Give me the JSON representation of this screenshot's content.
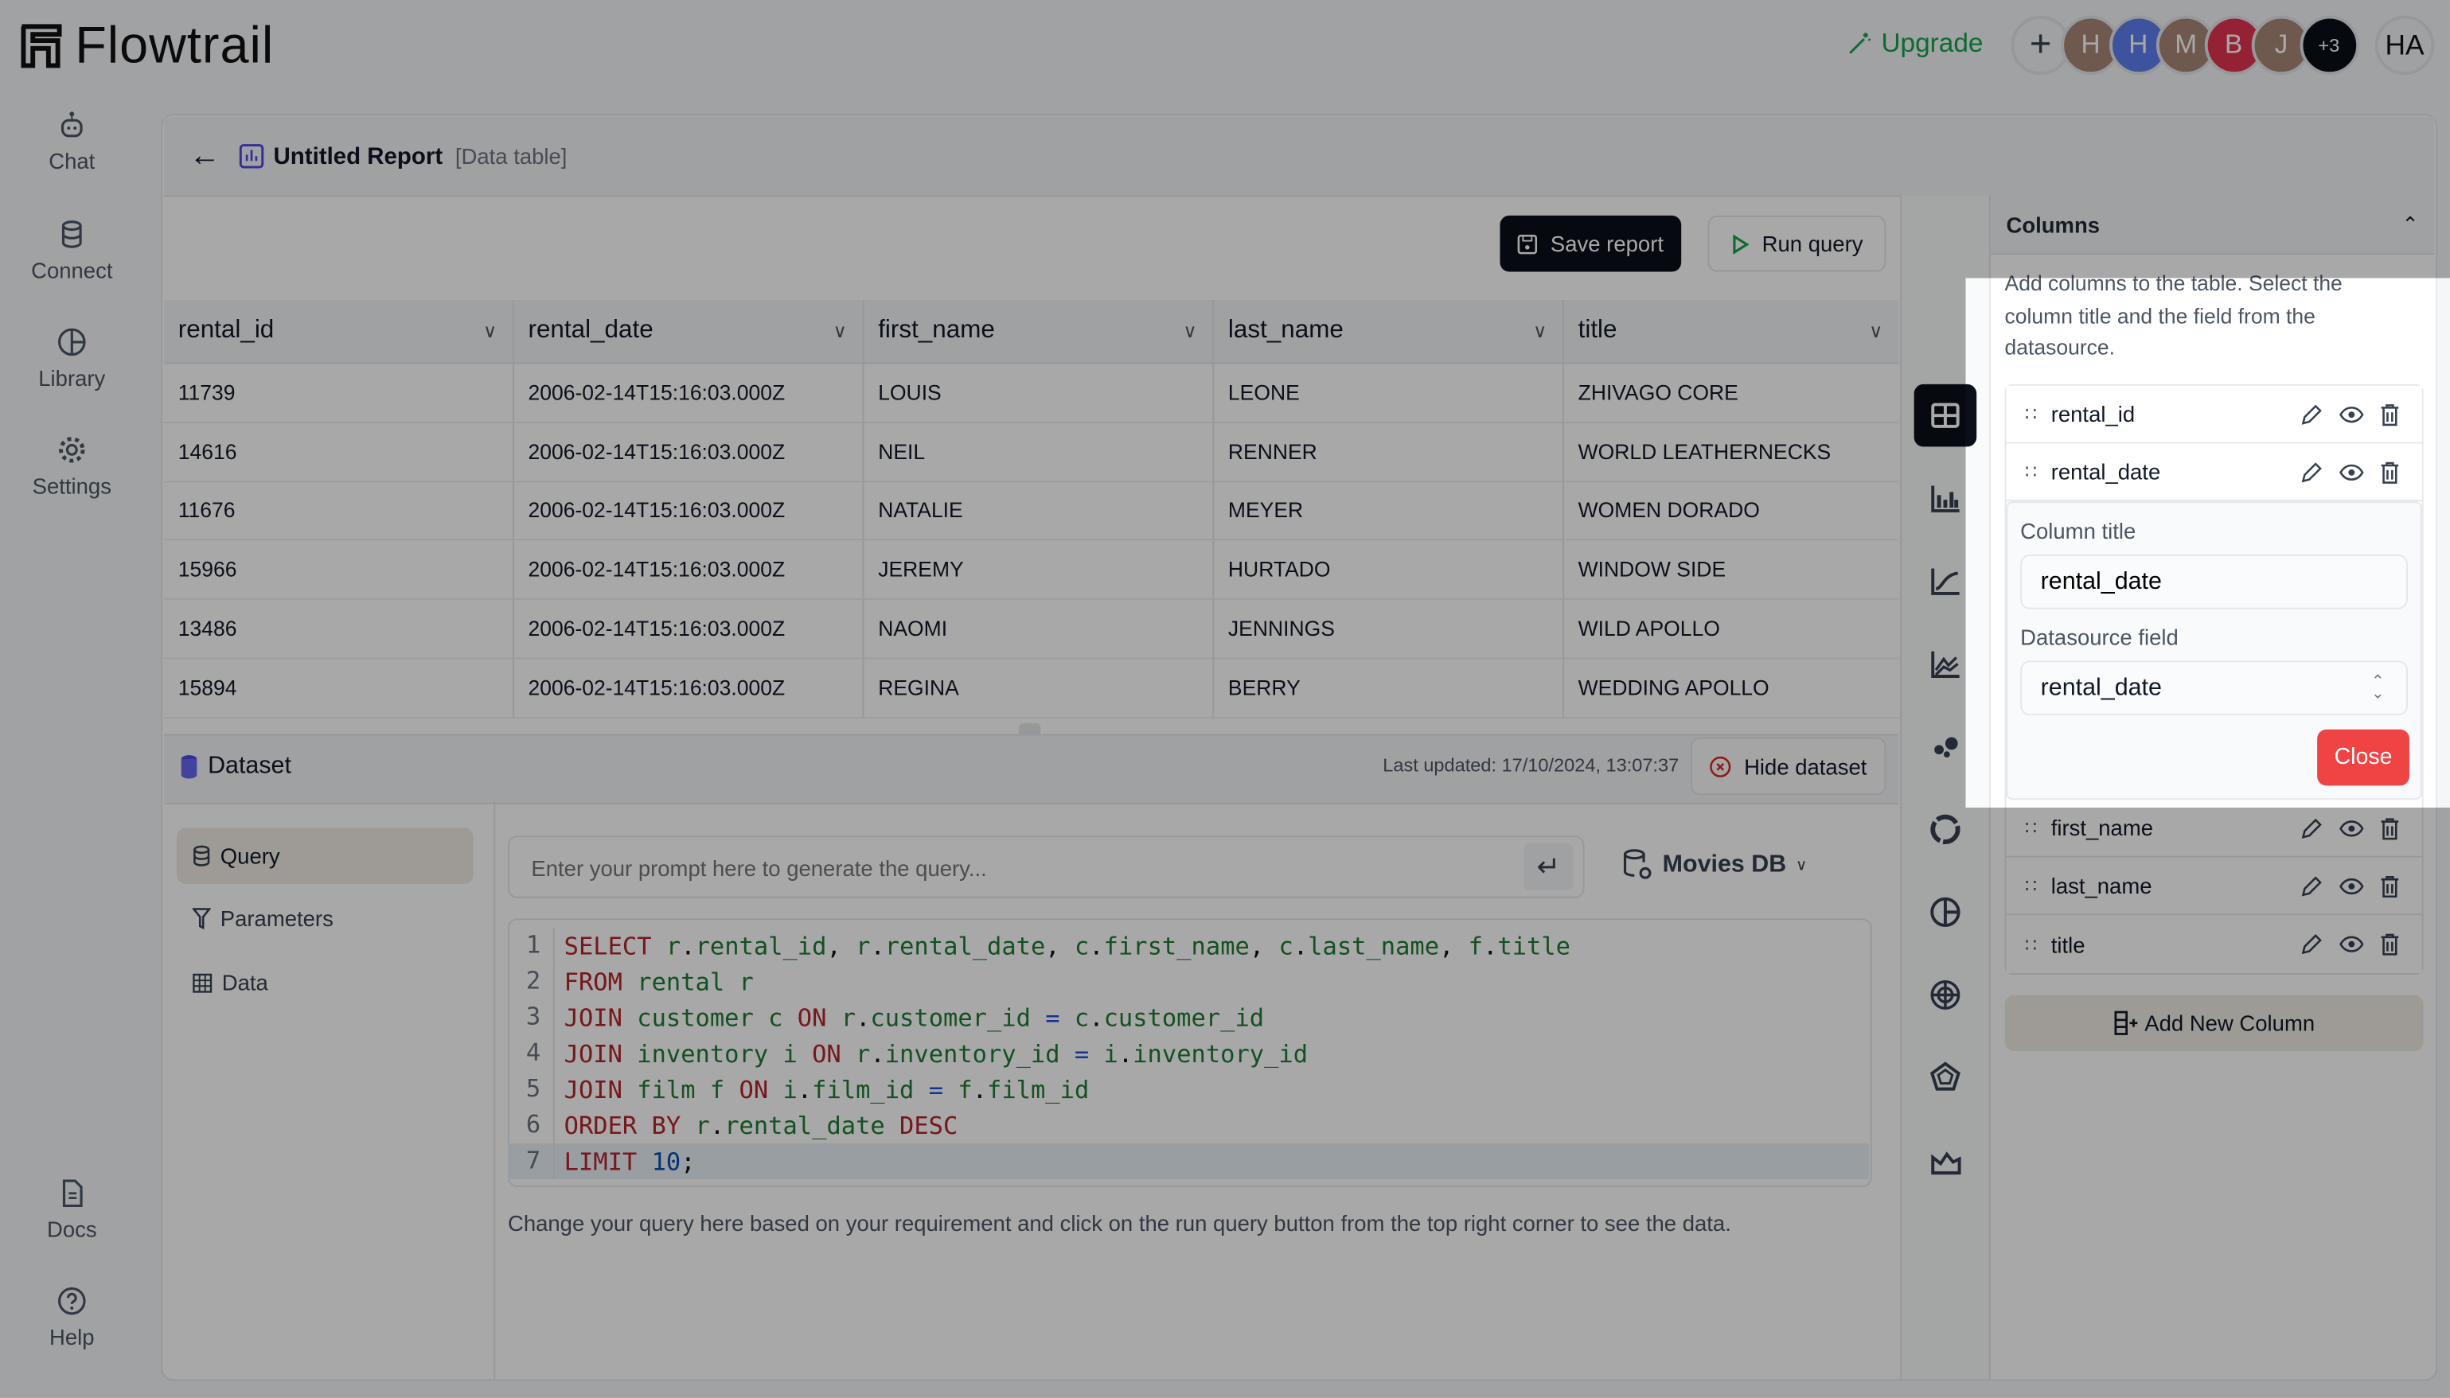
{
  "app": {
    "name": "Flowtrail"
  },
  "topbar": {
    "upgrade_label": "Upgrade",
    "add_member_label": "+",
    "avatars": [
      {
        "initial": "H",
        "color": "#a98677"
      },
      {
        "initial": "H",
        "color": "#5f7ef0"
      },
      {
        "initial": "M",
        "color": "#a98677"
      },
      {
        "initial": "B",
        "color": "#e2334f"
      },
      {
        "initial": "J",
        "color": "#a98677"
      },
      {
        "initial": "+3",
        "color": "#0b0f1a"
      }
    ],
    "user_initials": "HA"
  },
  "sidebar": {
    "items": [
      {
        "label": "Chat",
        "icon": "bot-icon"
      },
      {
        "label": "Connect",
        "icon": "database-icon"
      },
      {
        "label": "Library",
        "icon": "library-icon"
      },
      {
        "label": "Settings",
        "icon": "gear-icon"
      },
      {
        "label": "Docs",
        "icon": "document-icon"
      },
      {
        "label": "Help",
        "icon": "help-icon"
      }
    ]
  },
  "report": {
    "title": "Untitled Report",
    "type": "[Data table]",
    "save_label": "Save report",
    "run_label": "Run query"
  },
  "table": {
    "columns": [
      "rental_id",
      "rental_date",
      "first_name",
      "last_name",
      "title"
    ],
    "rows": [
      [
        "11739",
        "2006-02-14T15:16:03.000Z",
        "LOUIS",
        "LEONE",
        "ZHIVAGO CORE"
      ],
      [
        "14616",
        "2006-02-14T15:16:03.000Z",
        "NEIL",
        "RENNER",
        "WORLD LEATHERNECKS"
      ],
      [
        "11676",
        "2006-02-14T15:16:03.000Z",
        "NATALIE",
        "MEYER",
        "WOMEN DORADO"
      ],
      [
        "15966",
        "2006-02-14T15:16:03.000Z",
        "JEREMY",
        "HURTADO",
        "WINDOW SIDE"
      ],
      [
        "13486",
        "2006-02-14T15:16:03.000Z",
        "NAOMI",
        "JENNINGS",
        "WILD APOLLO"
      ],
      [
        "15894",
        "2006-02-14T15:16:03.000Z",
        "REGINA",
        "BERRY",
        "WEDDING APOLLO"
      ]
    ]
  },
  "dataset": {
    "title": "Dataset",
    "last_updated": "Last updated: 17/10/2024, 13:07:37",
    "hide_label": "Hide dataset",
    "nav": [
      {
        "label": "Query",
        "selected": true
      },
      {
        "label": "Parameters",
        "selected": false
      },
      {
        "label": "Data",
        "selected": false
      }
    ],
    "prompt_placeholder": "Enter your prompt here to generate the query...",
    "datasource": "Movies DB",
    "code": [
      [
        [
          "kw",
          "SELECT "
        ],
        [
          "id",
          "r"
        ],
        [
          "p",
          "."
        ],
        [
          "id",
          "rental_id"
        ],
        [
          "p",
          ", "
        ],
        [
          "id",
          "r"
        ],
        [
          "p",
          "."
        ],
        [
          "id",
          "rental_date"
        ],
        [
          "p",
          ", "
        ],
        [
          "id",
          "c"
        ],
        [
          "p",
          "."
        ],
        [
          "id",
          "first_name"
        ],
        [
          "p",
          ", "
        ],
        [
          "id",
          "c"
        ],
        [
          "p",
          "."
        ],
        [
          "id",
          "last_name"
        ],
        [
          "p",
          ", "
        ],
        [
          "id",
          "f"
        ],
        [
          "p",
          "."
        ],
        [
          "id",
          "title"
        ]
      ],
      [
        [
          "kw",
          "FROM "
        ],
        [
          "id",
          "rental r"
        ]
      ],
      [
        [
          "kw",
          "JOIN "
        ],
        [
          "id",
          "customer c "
        ],
        [
          "kw",
          "ON "
        ],
        [
          "id",
          "r"
        ],
        [
          "p",
          "."
        ],
        [
          "id",
          "customer_id "
        ],
        [
          "op",
          "= "
        ],
        [
          "id",
          "c"
        ],
        [
          "p",
          "."
        ],
        [
          "id",
          "customer_id"
        ]
      ],
      [
        [
          "kw",
          "JOIN "
        ],
        [
          "id",
          "inventory i "
        ],
        [
          "kw",
          "ON "
        ],
        [
          "id",
          "r"
        ],
        [
          "p",
          "."
        ],
        [
          "id",
          "inventory_id "
        ],
        [
          "op",
          "= "
        ],
        [
          "id",
          "i"
        ],
        [
          "p",
          "."
        ],
        [
          "id",
          "inventory_id"
        ]
      ],
      [
        [
          "kw",
          "JOIN "
        ],
        [
          "id",
          "film f "
        ],
        [
          "kw",
          "ON "
        ],
        [
          "id",
          "i"
        ],
        [
          "p",
          "."
        ],
        [
          "id",
          "film_id "
        ],
        [
          "op",
          "= "
        ],
        [
          "id",
          "f"
        ],
        [
          "p",
          "."
        ],
        [
          "id",
          "film_id"
        ]
      ],
      [
        [
          "kw",
          "ORDER BY "
        ],
        [
          "id",
          "r"
        ],
        [
          "p",
          "."
        ],
        [
          "id",
          "rental_date "
        ],
        [
          "kw",
          "DESC"
        ]
      ],
      [
        [
          "kw",
          "LIMIT "
        ],
        [
          "num",
          "10"
        ],
        [
          "p",
          ";"
        ]
      ]
    ],
    "active_line": 7,
    "help_text": "Change your query here based on your requirement and click on the run query button from the top right corner to see the data."
  },
  "chart_types": [
    "table-icon",
    "bar-chart-icon",
    "line-chart-icon",
    "multi-line-chart-icon",
    "scatter-icon",
    "donut-icon",
    "pie-icon",
    "radar-icon",
    "pentagon-icon",
    "area-chart-icon"
  ],
  "columns_panel": {
    "title": "Columns",
    "description": "Add columns to the table. Select the column title and the field from the datasource.",
    "items": [
      "rental_id",
      "rental_date",
      "first_name",
      "last_name",
      "title"
    ],
    "editor": {
      "title_label": "Column title",
      "title_value": "rental_date",
      "field_label": "Datasource field",
      "field_value": "rental_date",
      "close_label": "Close",
      "close_color": "#ef4444"
    },
    "add_label": "Add New Column"
  }
}
